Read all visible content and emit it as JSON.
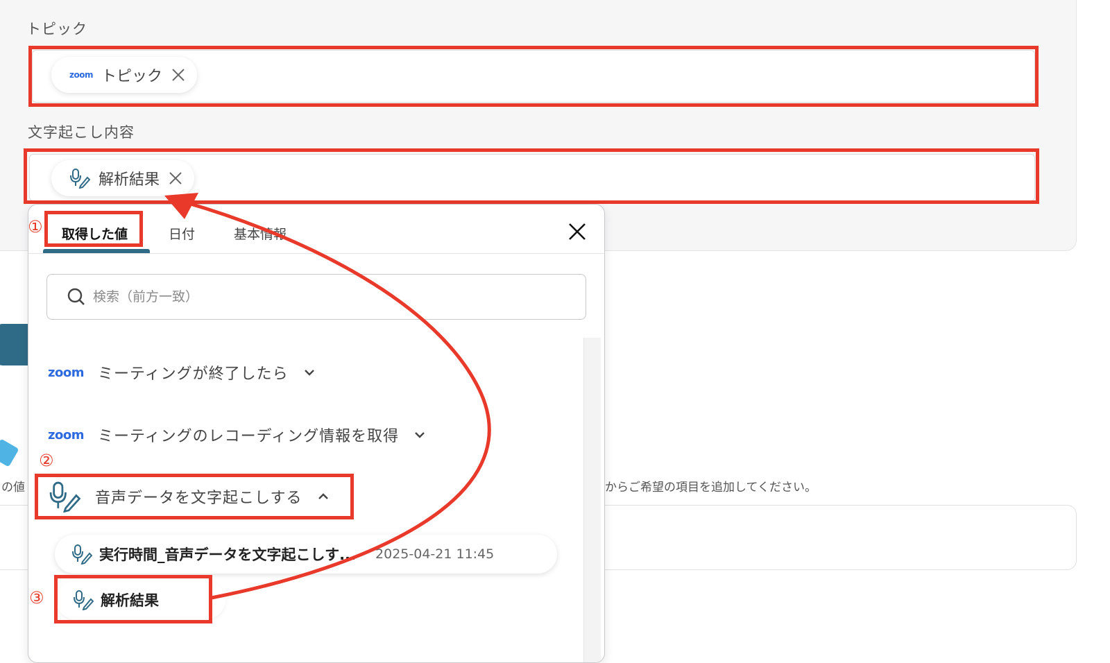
{
  "fields": {
    "topic": {
      "label": "トピック",
      "chip_logo": "zoom",
      "chip_label": "トピック"
    },
    "transcript": {
      "label": "文字起こし内容",
      "chip_label": "解析結果"
    }
  },
  "background": {
    "text_left": "の値",
    "text_right": "からご希望の項目を追加してください。"
  },
  "dropdown": {
    "tabs": [
      {
        "label": "取得した値",
        "active": true
      },
      {
        "label": "日付"
      },
      {
        "label": "基本情報"
      }
    ],
    "search_placeholder": "検索（前方一致）",
    "sections": [
      {
        "logo": "zoom",
        "label": "ミーティングが終了したら",
        "expanded": false
      },
      {
        "logo": "zoom",
        "label": "ミーティングのレコーディング情報を取得",
        "expanded": false
      },
      {
        "icon": "mic-pen-icon",
        "label": "音声データを文字起こしする",
        "expanded": true
      }
    ],
    "values": [
      {
        "label": "実行時間_音声データを文字起こしす...",
        "timestamp": "2025-04-21 11:45"
      },
      {
        "label": "解析結果"
      }
    ]
  },
  "annotations": {
    "step1": "①",
    "step2": "②",
    "step3": "③",
    "color": "#e8392a"
  },
  "colors": {
    "accent": "#2f6b86",
    "zoom_blue": "#2d6ae0"
  }
}
